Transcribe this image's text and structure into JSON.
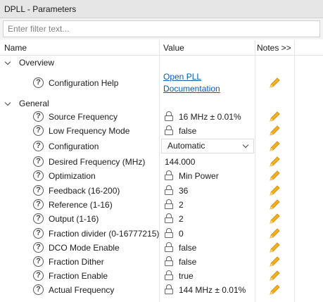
{
  "window": {
    "title": "DPLL - Parameters"
  },
  "filter": {
    "placeholder": "Enter filter text..."
  },
  "columns": {
    "name": "Name",
    "value": "Value",
    "notes": "Notes >>"
  },
  "groups": [
    {
      "label": "Overview"
    },
    {
      "label": "General"
    }
  ],
  "overview_rows": [
    {
      "name": "Configuration Help",
      "link_line1": "Open PLL",
      "link_line2": "Documentation"
    }
  ],
  "general_rows": [
    {
      "name": "Source Frequency",
      "value": "16 MHz ± 0.01%",
      "locked": true
    },
    {
      "name": "Low Frequency Mode",
      "value": "false",
      "locked": true
    },
    {
      "name": "Configuration",
      "value": "Automatic",
      "locked": false,
      "dropdown": true
    },
    {
      "name": "Desired Frequency (MHz)",
      "value": "144.000",
      "locked": false
    },
    {
      "name": "Optimization",
      "value": "Min Power",
      "locked": true
    },
    {
      "name": "Feedback (16-200)",
      "value": "36",
      "locked": true
    },
    {
      "name": "Reference (1-16)",
      "value": "2",
      "locked": true
    },
    {
      "name": "Output (1-16)",
      "value": "2",
      "locked": true
    },
    {
      "name": "Fraction divider (0-16777215)",
      "value": "0",
      "locked": true
    },
    {
      "name": "DCO Mode Enable",
      "value": "false",
      "locked": true
    },
    {
      "name": "Fraction Dither",
      "value": "false",
      "locked": true
    },
    {
      "name": "Fraction Enable",
      "value": "true",
      "locked": true
    },
    {
      "name": "Actual Frequency",
      "value": "144 MHz ± 0.01%",
      "locked": true
    }
  ],
  "icons": {
    "help": "question-circle-icon",
    "lock": "lock-icon",
    "note": "pencil-icon",
    "expand": "chevron-down-icon"
  },
  "colors": {
    "link": "#0b5cad",
    "pencil": "#f2b01e",
    "titlebar": "#e6e6e6"
  }
}
